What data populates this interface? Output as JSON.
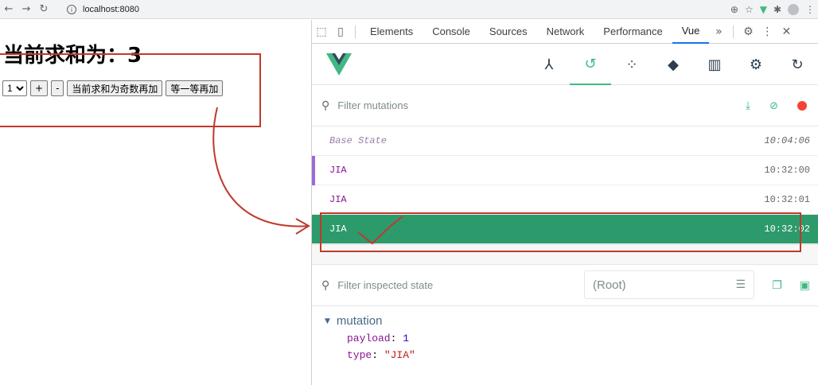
{
  "browser": {
    "url": "localhost:8080",
    "nav_back": "←",
    "nav_forward": "→",
    "nav_reload": "↻",
    "info_icon": "i"
  },
  "page": {
    "heading": "当前求和为：3",
    "select_value": "1",
    "buttons": {
      "plus": "+",
      "minus": "-",
      "odd_add": "当前求和为奇数再加",
      "wait_add": "等一等再加"
    }
  },
  "devtools": {
    "tabs": [
      "Elements",
      "Console",
      "Sources",
      "Network",
      "Performance",
      "Vue"
    ],
    "active_tab": "Vue",
    "more": "»",
    "mutations_filter_placeholder": "Filter mutations",
    "mutations": [
      {
        "name": "Base State",
        "time": "10:04:06"
      },
      {
        "name": "JIA",
        "time": "10:32:00"
      },
      {
        "name": "JIA",
        "time": "10:32:01"
      },
      {
        "name": "JIA",
        "time": "10:32:02"
      }
    ],
    "inspect_filter_placeholder": "Filter inspected state",
    "root_select": "(Root)",
    "tree_title": "mutation",
    "payload_key": "payload",
    "payload_value": "1",
    "type_key": "type",
    "type_value": "\"JIA\""
  },
  "colors": {
    "vue_green": "#42b983",
    "selected_row": "#2d9a6c",
    "annotation_red": "#c0392b",
    "mutation_purple": "#881391"
  }
}
